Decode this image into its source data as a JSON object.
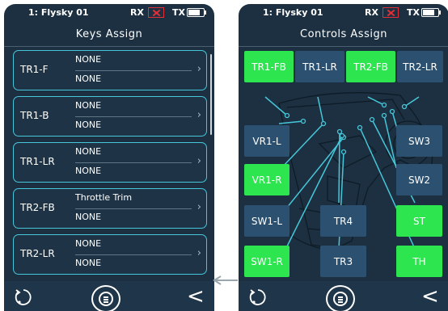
{
  "left": {
    "status": {
      "model": "1: Flysky  01",
      "rx": "RX",
      "tx": "TX"
    },
    "title": "Keys Assign",
    "keys": [
      {
        "name": "TR1-F",
        "line1": "NONE",
        "line2": "NONE"
      },
      {
        "name": "TR1-B",
        "line1": "NONE",
        "line2": "NONE"
      },
      {
        "name": "TR1-LR",
        "line1": "NONE",
        "line2": "NONE"
      },
      {
        "name": "TR2-FB",
        "line1": "Throttle Trim",
        "line2": "NONE"
      },
      {
        "name": "TR2-LR",
        "line1": "NONE",
        "line2": "NONE"
      }
    ]
  },
  "right": {
    "status": {
      "model": "1: Flysky  01",
      "rx": "RX",
      "tx": "TX"
    },
    "title": "Controls Assign",
    "controls": [
      {
        "label": "TR1-FB",
        "active": true
      },
      {
        "label": "TR1-LR",
        "active": false
      },
      {
        "label": "TR2-FB",
        "active": true
      },
      {
        "label": "TR2-LR",
        "active": false
      },
      {
        "label": "VR1-L",
        "active": false
      },
      {
        "label": "SW3",
        "active": false
      },
      {
        "label": "VR1-R",
        "active": true
      },
      {
        "label": "SW2",
        "active": false
      },
      {
        "label": "SW1-L",
        "active": false
      },
      {
        "label": "TR4",
        "active": false
      },
      {
        "label": "ST",
        "active": true
      },
      {
        "label": "SW1-R",
        "active": true
      },
      {
        "label": "TR3",
        "active": false
      },
      {
        "label": "TH",
        "active": true
      }
    ]
  },
  "colors": {
    "active": "#2ce54f",
    "inactive": "#2c5170",
    "accent": "#46c7d9",
    "background": "#1c3041"
  },
  "icons": {
    "refresh": "refresh-icon",
    "menu": "menu-icon",
    "back": "back-chevron-icon",
    "battery": "battery-icon",
    "rx-status": "rx-disconnected-icon"
  }
}
